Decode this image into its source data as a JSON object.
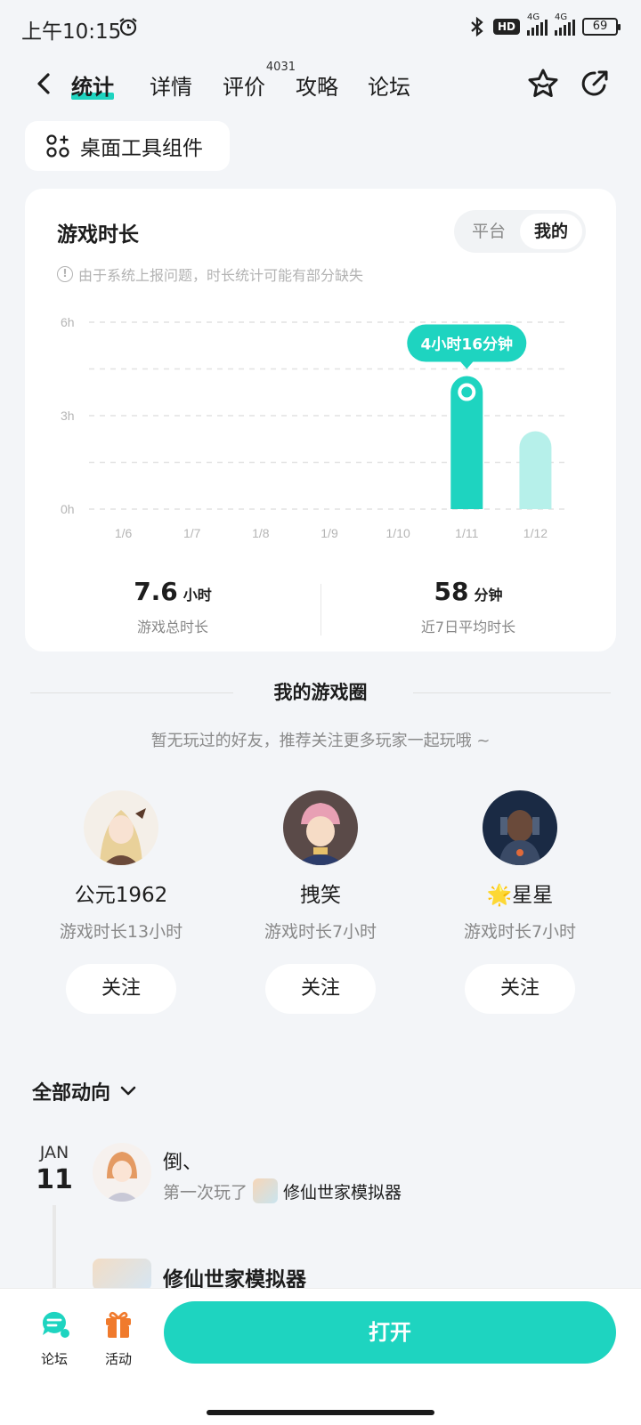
{
  "status_bar": {
    "time": "上午10:15",
    "hd_label": "HD",
    "net1": "4G",
    "net2": "4G",
    "battery": "69"
  },
  "nav": {
    "tabs": [
      {
        "label": "统计"
      },
      {
        "label": "详情"
      },
      {
        "label": "评价",
        "badge": "4031"
      },
      {
        "label": "攻略"
      },
      {
        "label": "论坛"
      }
    ]
  },
  "widget_button": {
    "label": "桌面工具组件"
  },
  "playtime_card": {
    "title": "游戏时长",
    "segments": [
      "平台",
      "我的"
    ],
    "selected_segment": "我的",
    "notice": "由于系统上报问题，时长统计可能有部分缺失",
    "total_value": "7.6",
    "total_unit": "小时",
    "total_label": "游戏总时长",
    "avg_value": "58",
    "avg_unit": "分钟",
    "avg_label": "近7日平均时长"
  },
  "chart_data": {
    "type": "bar",
    "categories": [
      "1/6",
      "1/7",
      "1/8",
      "1/9",
      "1/10",
      "1/11",
      "1/12"
    ],
    "values": [
      0,
      0,
      0,
      0,
      0,
      4.27,
      2.5
    ],
    "y_ticks": [
      "0h",
      "3h",
      "6h"
    ],
    "ylim": [
      0,
      6
    ],
    "highlight_index": 5,
    "tooltip": "4小时16分钟",
    "colors": {
      "active": "#1ed4c0",
      "inactive": "#b6f0ea"
    }
  },
  "game_circle": {
    "title": "我的游戏圈",
    "subtitle": "暂无玩过的好友，推荐关注更多玩家一起玩哦 ~",
    "follow_label": "关注",
    "friends": [
      {
        "name": "公元1962",
        "playtime": "游戏时长13小时"
      },
      {
        "name": "拽笑",
        "playtime": "游戏时长7小时"
      },
      {
        "name": "🌟星星",
        "playtime": "游戏时长7小时"
      }
    ]
  },
  "feed": {
    "filter_label": "全部动向",
    "date_month": "JAN",
    "date_day": "11",
    "post1": {
      "user": "倒、",
      "action": "第一次玩了",
      "game": "修仙世家模拟器"
    },
    "post2": {
      "game": "修仙世家模拟器"
    }
  },
  "bottom_bar": {
    "forum_label": "论坛",
    "activity_label": "活动",
    "open_label": "打开"
  }
}
